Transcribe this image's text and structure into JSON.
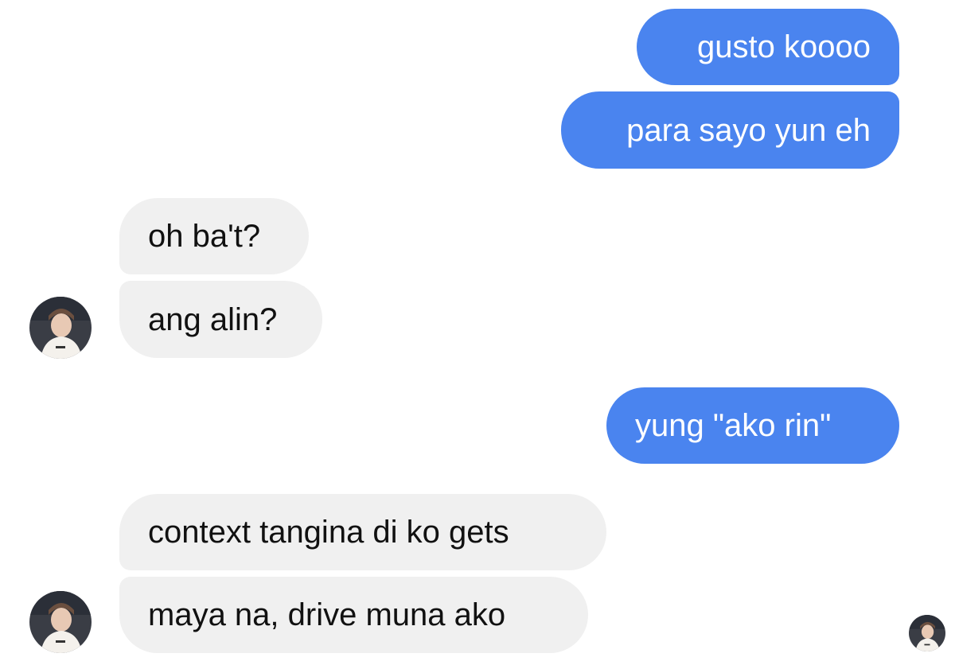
{
  "conversation": {
    "messages": [
      {
        "direction": "outgoing",
        "text": "gusto koooo"
      },
      {
        "direction": "outgoing",
        "text": "para sayo yun eh"
      },
      {
        "direction": "incoming",
        "text": "oh ba't?"
      },
      {
        "direction": "incoming",
        "text": "ang alin?"
      },
      {
        "direction": "outgoing",
        "text": "yung \"ako rin\""
      },
      {
        "direction": "incoming",
        "text": "context tangina di ko gets"
      },
      {
        "direction": "incoming",
        "text": "maya na, drive muna ako"
      }
    ],
    "avatars": [
      {
        "icon": "contact-avatar-photo"
      },
      {
        "icon": "contact-avatar-photo"
      },
      {
        "icon": "read-receipt-avatar-photo"
      }
    ]
  },
  "colors": {
    "outgoing_bubble": "#4a84ef",
    "incoming_bubble": "#f0f0f0",
    "outgoing_text": "#ffffff",
    "incoming_text": "#111111"
  }
}
